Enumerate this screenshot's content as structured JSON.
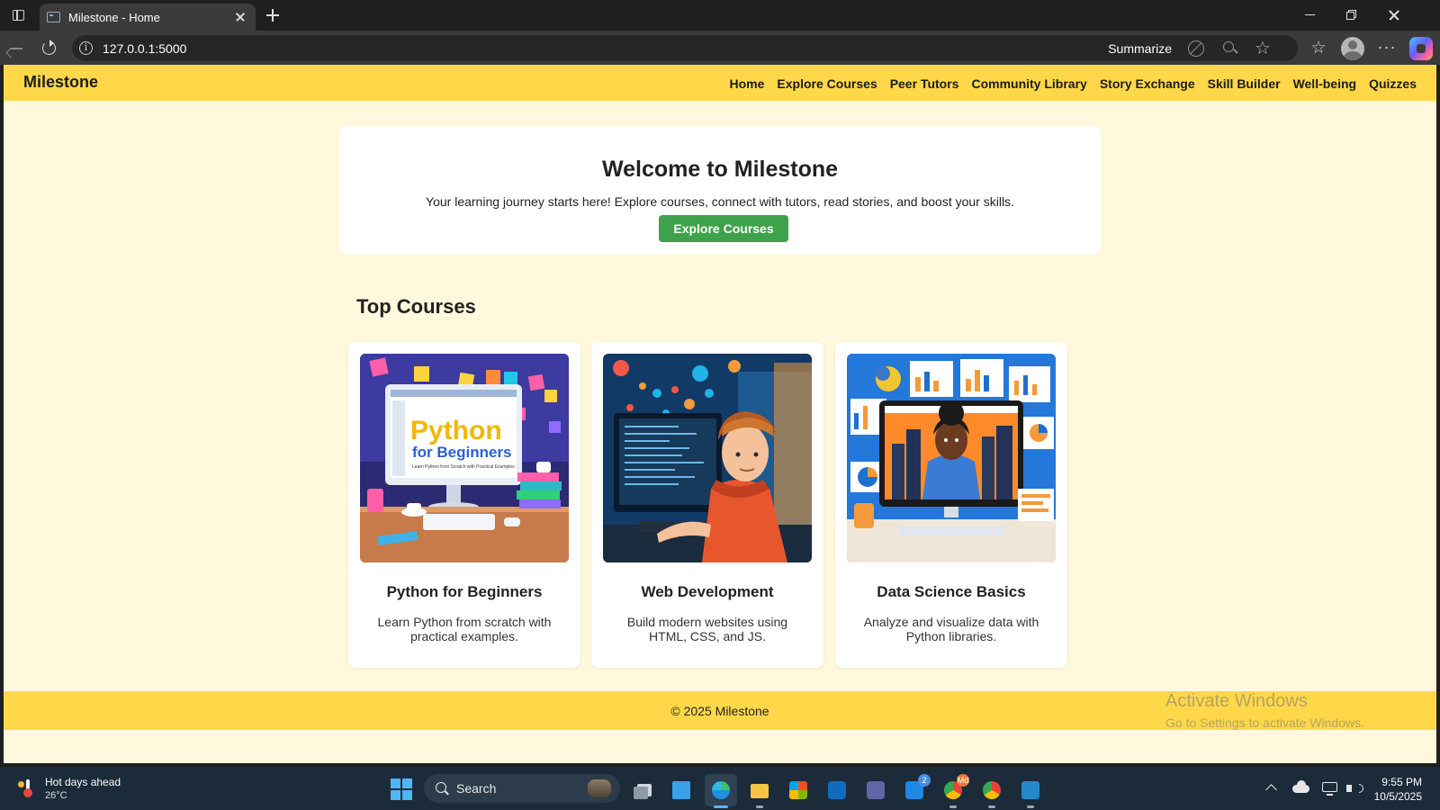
{
  "browser": {
    "tab_title": "Milestone - Home",
    "url": "127.0.0.1:5000",
    "summarize_label": "Summarize"
  },
  "site": {
    "brand": "Milestone",
    "nav": [
      {
        "label": "Home"
      },
      {
        "label": "Explore Courses"
      },
      {
        "label": "Peer Tutors"
      },
      {
        "label": "Community Library"
      },
      {
        "label": "Story Exchange"
      },
      {
        "label": "Skill Builder"
      },
      {
        "label": "Well-being"
      },
      {
        "label": "Quizzes"
      }
    ],
    "hero": {
      "title": "Welcome to Milestone",
      "subtitle": "Your learning journey starts here! Explore courses, connect with tutors, read stories, and boost your skills.",
      "cta_label": "Explore Courses"
    },
    "top_courses_heading": "Top Courses",
    "courses": [
      {
        "title": "Python for Beginners",
        "description": "Learn Python from scratch with practical examples.",
        "image_text_main": "Python",
        "image_text_sub": "for Beginners",
        "image_text_tagline": "Learn Python from Scratch with Practical Examples"
      },
      {
        "title": "Web Development",
        "description": "Build modern websites using HTML, CSS, and JS."
      },
      {
        "title": "Data Science Basics",
        "description": "Analyze and visualize data with Python libraries."
      }
    ],
    "footer": "© 2025 Milestone"
  },
  "watermark": {
    "line1": "Activate Windows",
    "line2": "Go to Settings to activate Windows."
  },
  "taskbar": {
    "weather_title": "Hot days ahead",
    "weather_temp": "26°C",
    "search_label": "Search",
    "teams_badge": "2",
    "chrome_badge": "Md",
    "time": "9:55 PM",
    "date": "10/5/2025"
  },
  "colors": {
    "header_yellow": "#ffd84a",
    "page_background": "#fff8dc",
    "cta_green": "#3ea24a"
  }
}
